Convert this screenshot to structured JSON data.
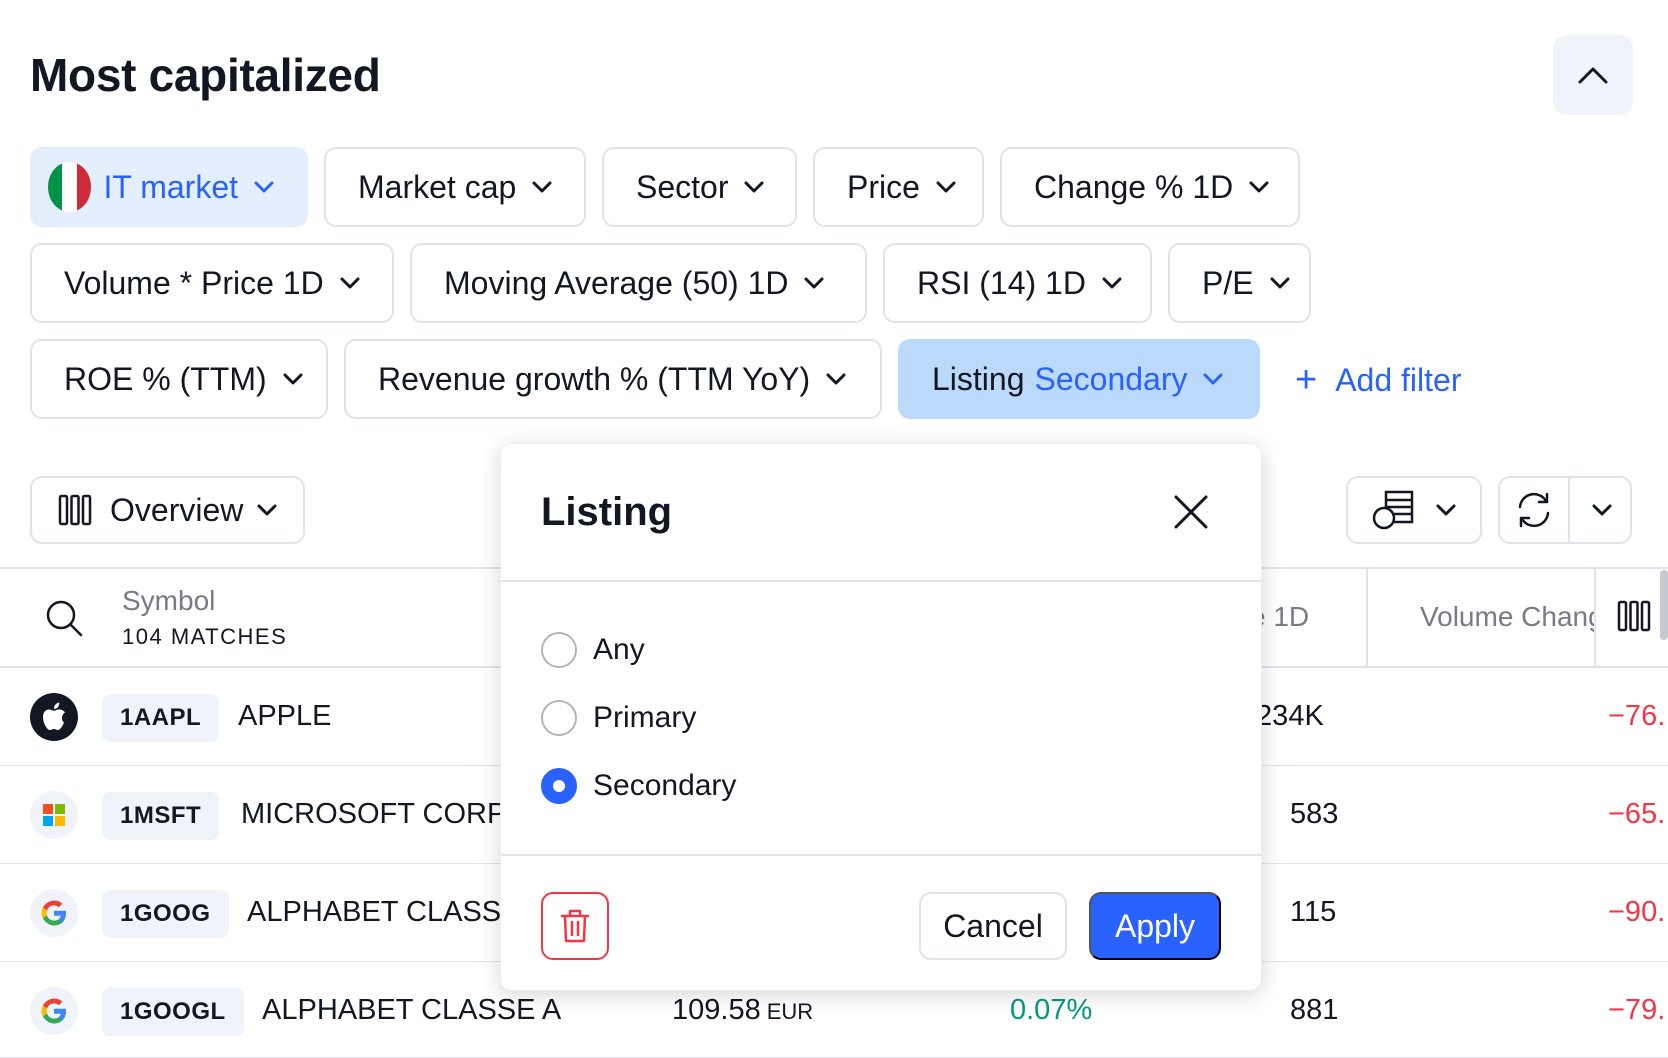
{
  "page": {
    "title": "Most capitalized"
  },
  "filters": {
    "market": "IT market",
    "market_cap": "Market cap",
    "sector": "Sector",
    "price": "Price",
    "change": "Change % 1D",
    "volume_price": "Volume * Price 1D",
    "moving_average": "Moving Average (50) 1D",
    "rsi": "RSI (14) 1D",
    "pe": "P/E",
    "roe": "ROE % (TTM)",
    "revenue_growth": "Revenue growth % (TTM YoY)",
    "listing_label": "Listing",
    "listing_value": "Secondary",
    "add_filter": "Add filter",
    "add_filter_symbol": "+"
  },
  "toolbar": {
    "overview": "Overview"
  },
  "table": {
    "header": {
      "symbol": "Symbol",
      "matches": "104 MATCHES",
      "change_1d_partial": "e 1D",
      "volume_change_partial": "Volume Chang"
    },
    "rows": [
      {
        "ticker": "1AAPL",
        "name": "APPLE",
        "volume": ".234K",
        "vol_change": "−76."
      },
      {
        "ticker": "1MSFT",
        "name": "MICROSOFT CORP",
        "volume": "583",
        "vol_change": "−65."
      },
      {
        "ticker": "1GOOG",
        "name": "ALPHABET CLASSE",
        "volume": "115",
        "vol_change": "−90."
      },
      {
        "ticker": "1GOOGL",
        "name": "ALPHABET CLASSE A",
        "price": "109.58",
        "currency": "EUR",
        "change": "0.07%",
        "volume": "881",
        "vol_change": "−79."
      }
    ]
  },
  "modal": {
    "title": "Listing",
    "options": [
      "Any",
      "Primary",
      "Secondary"
    ],
    "selected": "Secondary",
    "cancel": "Cancel",
    "apply": "Apply"
  },
  "colors": {
    "accent": "#2962ff",
    "negative": "#f23645",
    "positive": "#089981",
    "chip_active": "#bbd9fb",
    "chip_market": "#e3effd"
  },
  "icons": {
    "collapse": "chevron-up-icon",
    "flag": "italy-flag-icon",
    "columns": "columns-icon",
    "table_settings": "table-settings-icon",
    "refresh": "refresh-icon",
    "search": "search-icon",
    "close": "close-icon",
    "delete": "trash-icon"
  }
}
